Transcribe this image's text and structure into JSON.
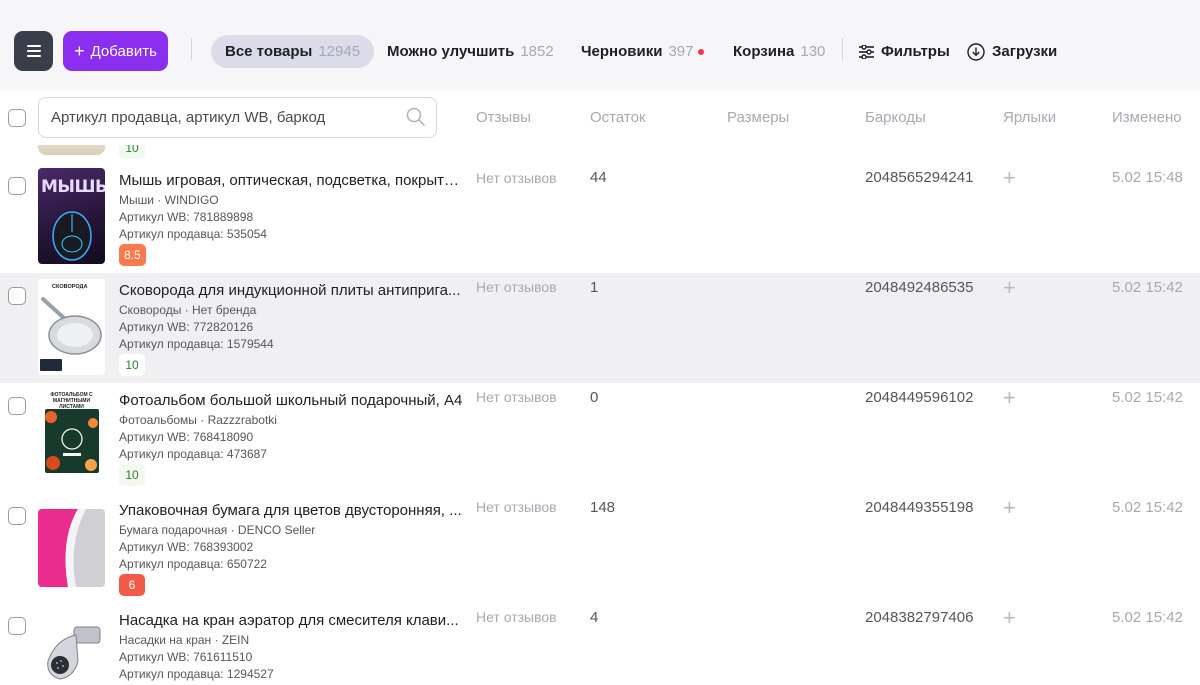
{
  "toolbar": {
    "add_label": "Добавить",
    "tabs": [
      {
        "label": "Все товары",
        "count": "12945"
      },
      {
        "label": "Можно улучшить",
        "count": "1852"
      },
      {
        "label": "Черновики",
        "count": "397"
      },
      {
        "label": "Корзина",
        "count": "130"
      }
    ],
    "filters_label": "Фильтры",
    "downloads_label": "Загрузки"
  },
  "search": {
    "placeholder": "Артикул продавца, артикул WB, баркод"
  },
  "columns": [
    "Отзывы",
    "Остаток",
    "Размеры",
    "Баркоды",
    "Ярлыки",
    "Изменено"
  ],
  "partial_row": {
    "rating": "10"
  },
  "products": [
    {
      "title": "Мышь игровая, оптическая, подсветка, покрыти...",
      "category_brand": "Мыши · WINDIGO",
      "wb_article": "Артикул WB: 781889898",
      "seller_article": "Артикул продавца: 535054",
      "rating": "8.5",
      "reviews": "Нет отзывов",
      "stock": "44",
      "barcode": "2048565294241",
      "label_action": "+",
      "changed": "5.02 15:48",
      "thumb_text": "МЫШЬ"
    },
    {
      "title": "Сковорода для индукционной плиты антиприга...",
      "category_brand": "Сковороды · Нет бренда",
      "wb_article": "Артикул WB: 772820126",
      "seller_article": "Артикул продавца: 1579544",
      "rating": "10",
      "reviews": "Нет отзывов",
      "stock": "1",
      "barcode": "2048492486535",
      "label_action": "+",
      "changed": "5.02 15:42",
      "thumb_text": "СКОВОРОДА"
    },
    {
      "title": "Фотоальбом большой школьный подарочный, А4",
      "category_brand": "Фотоальбомы · Razzzrabotki",
      "wb_article": "Артикул WB: 768418090",
      "seller_article": "Артикул продавца: 473687",
      "rating": "10",
      "reviews": "Нет отзывов",
      "stock": "0",
      "barcode": "2048449596102",
      "label_action": "+",
      "changed": "5.02 15:42",
      "thumb_text": "ФОТОАЛЬБОМ С МАГНИТНЫМИ ЛИСТАМИ"
    },
    {
      "title": "Упаковочная бумага для цветов двусторонняя, ...",
      "category_brand": "Бумага подарочная · DENCO Seller",
      "wb_article": "Артикул WB: 768393002",
      "seller_article": "Артикул продавца: 650722",
      "rating": "6",
      "reviews": "Нет отзывов",
      "stock": "148",
      "barcode": "2048449355198",
      "label_action": "+",
      "changed": "5.02 15:42",
      "thumb_text": ""
    },
    {
      "title": "Насадка на кран аэратор для смесителя клави...",
      "category_brand": "Насадки на кран · ZEIN",
      "wb_article": "Артикул WB: 761611510",
      "seller_article": "Артикул продавца: 1294527",
      "rating": "",
      "reviews": "Нет отзывов",
      "stock": "4",
      "barcode": "2048382797406",
      "label_action": "+",
      "changed": "5.02 15:42",
      "thumb_text": ""
    }
  ]
}
